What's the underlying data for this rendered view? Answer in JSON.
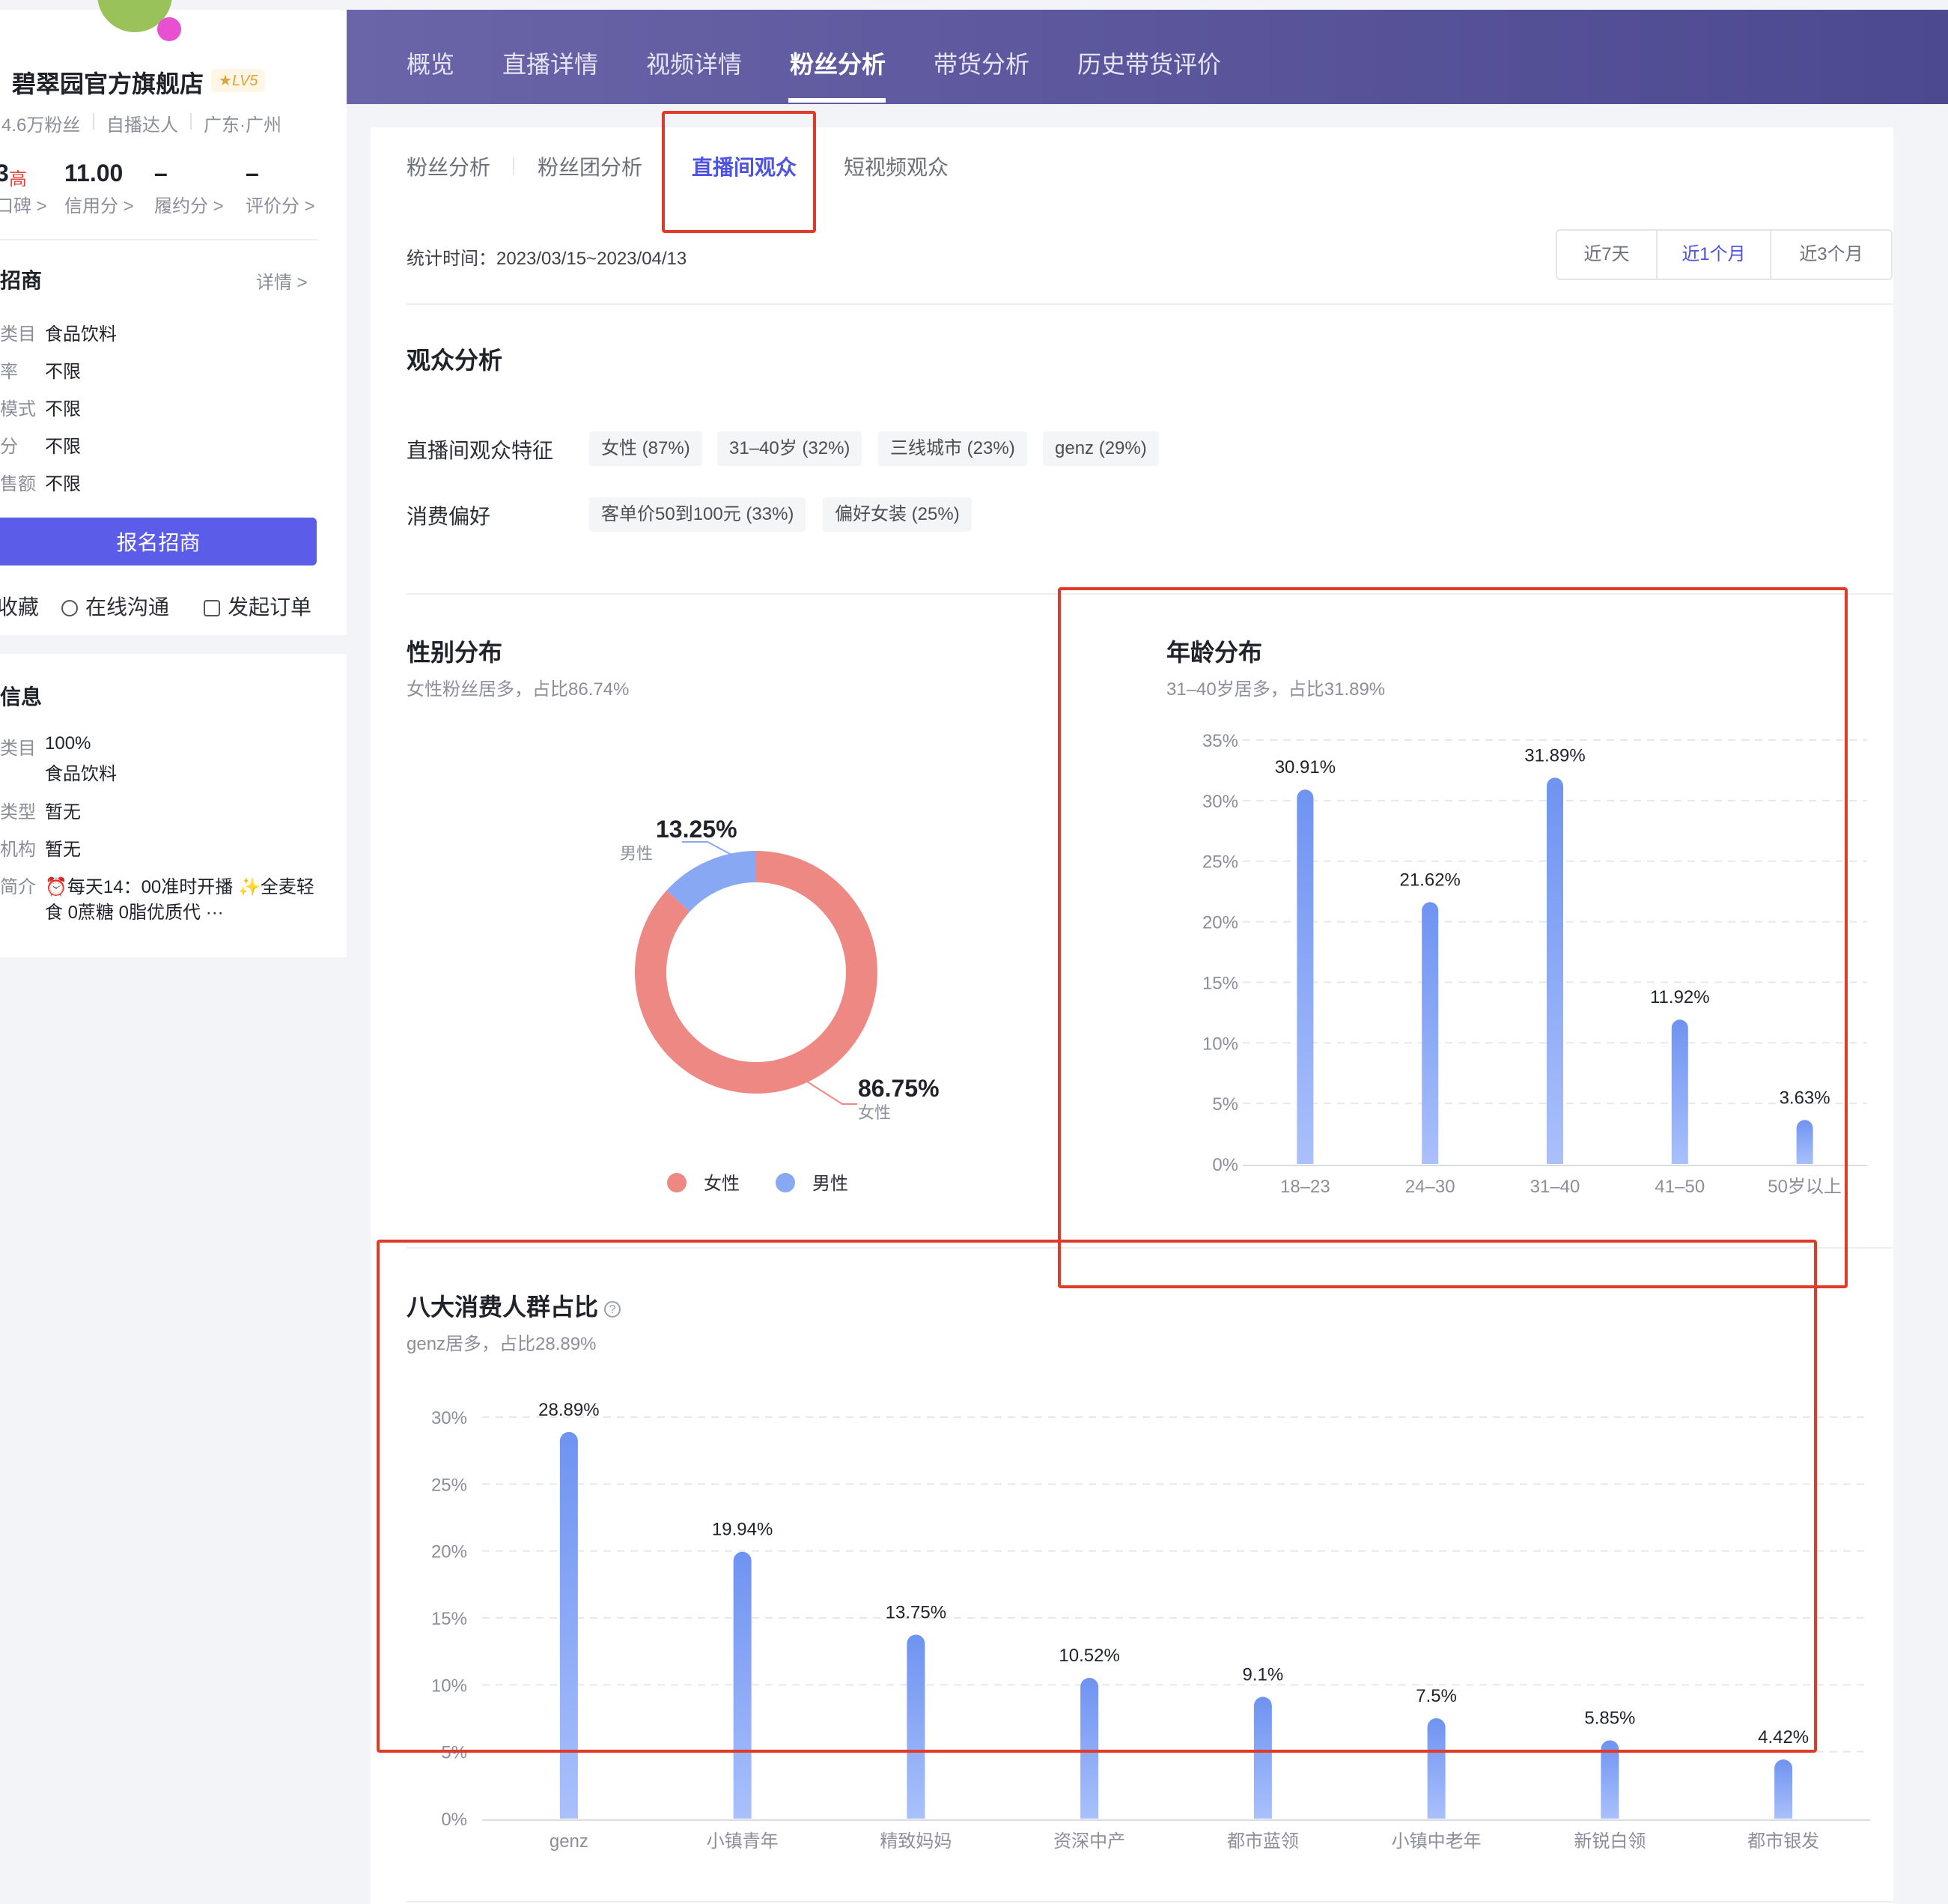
{
  "sidebar": {
    "shop_name": "碧翠园官方旗舰店",
    "level": "LV5",
    "fans": "4.6万粉丝",
    "talent_type": "自播达人",
    "location": "广东·广州",
    "scores": [
      {
        "value": "3",
        "badge": "高",
        "label": "口碑 >"
      },
      {
        "value": "11.00",
        "label": "信用分 >"
      },
      {
        "value": "–",
        "label": "履约分 >"
      },
      {
        "value": "–",
        "label": "评价分 >"
      }
    ],
    "merchant_title": "招商",
    "detail_link": "详情 >",
    "merchant_rows": [
      {
        "key": "类目",
        "value": "食品饮料"
      },
      {
        "key": "率",
        "value": "不限"
      },
      {
        "key": "模式",
        "value": "不限"
      },
      {
        "key": "分",
        "value": "不限"
      },
      {
        "key": "售额",
        "value": "不限"
      }
    ],
    "join_button": "报名招商",
    "actions": [
      "收藏",
      "在线沟通",
      "发起订单"
    ],
    "info_title": "信息",
    "info_rows": [
      {
        "key": "类目",
        "value": "100%",
        "value2": "食品饮料"
      },
      {
        "key": "类型",
        "value": "暂无"
      },
      {
        "key": "机构",
        "value": "暂无"
      },
      {
        "key": "简介",
        "value": "⏰每天14：00准时开播 ✨全麦轻",
        "value2": "食 0蔗糖 0脂优质代 ···"
      }
    ]
  },
  "topnav": {
    "items": [
      "概览",
      "直播详情",
      "视频详情",
      "粉丝分析",
      "带货分析",
      "历史带货评价"
    ],
    "active": "粉丝分析"
  },
  "subtabs": {
    "items": [
      "粉丝分析",
      "粉丝团分析",
      "直播间观众",
      "短视频观众"
    ],
    "active": "直播间观众"
  },
  "stat_time": "统计时间：2023/03/15~2023/04/13",
  "range_options": [
    "近7天",
    "近1个月",
    "近3个月"
  ],
  "range_active": "近1个月",
  "audience": {
    "title": "观众分析",
    "feature_label": "直播间观众特征",
    "features": [
      "女性 (87%)",
      "31–40岁 (32%)",
      "三线城市 (23%)",
      "genz (29%)"
    ],
    "pref_label": "消费偏好",
    "prefs": [
      "客单价50到100元 (33%)",
      "偏好女装 (25%)"
    ]
  },
  "gender": {
    "title": "性别分布",
    "subtitle": "女性粉丝居多，占比86.74%",
    "male_pct": "13.25%",
    "male_label": "男性",
    "female_pct": "86.75%",
    "female_label": "女性",
    "legend": [
      "女性",
      "男性"
    ],
    "colors": {
      "female": "#ee8883",
      "male": "#88a8f3"
    }
  },
  "age": {
    "title": "年龄分布",
    "subtitle": "31–40岁居多，占比31.89%"
  },
  "consumer": {
    "title": "八大消费人群占比",
    "subtitle": "genz居多，占比28.89%"
  },
  "chart_data": [
    {
      "type": "pie",
      "categories": [
        "女性",
        "男性"
      ],
      "values": [
        86.75,
        13.25
      ],
      "title": "性别分布"
    },
    {
      "type": "bar",
      "title": "年龄分布",
      "categories": [
        "18–23",
        "24–30",
        "31–40",
        "41–50",
        "50岁以上"
      ],
      "values": [
        30.91,
        21.62,
        31.89,
        11.92,
        3.63
      ],
      "labels": [
        "30.91%",
        "21.62%",
        "31.89%",
        "11.92%",
        "3.63%"
      ],
      "ylim": [
        0,
        35
      ],
      "yticks": [
        "0%",
        "5%",
        "10%",
        "15%",
        "20%",
        "25%",
        "30%",
        "35%"
      ],
      "grid": true
    },
    {
      "type": "bar",
      "title": "八大消费人群占比",
      "categories": [
        "genz",
        "小镇青年",
        "精致妈妈",
        "资深中产",
        "都市蓝领",
        "小镇中老年",
        "新锐白领",
        "都市银发"
      ],
      "values": [
        28.89,
        19.94,
        13.75,
        10.52,
        9.1,
        7.5,
        5.85,
        4.42
      ],
      "labels": [
        "28.89%",
        "19.94%",
        "13.75%",
        "10.52%",
        "9.1%",
        "7.5%",
        "5.85%",
        "4.42%"
      ],
      "ylim": [
        0,
        30
      ],
      "yticks": [
        "0%",
        "5%",
        "10%",
        "15%",
        "20%",
        "25%",
        "30%"
      ],
      "grid": true
    }
  ]
}
